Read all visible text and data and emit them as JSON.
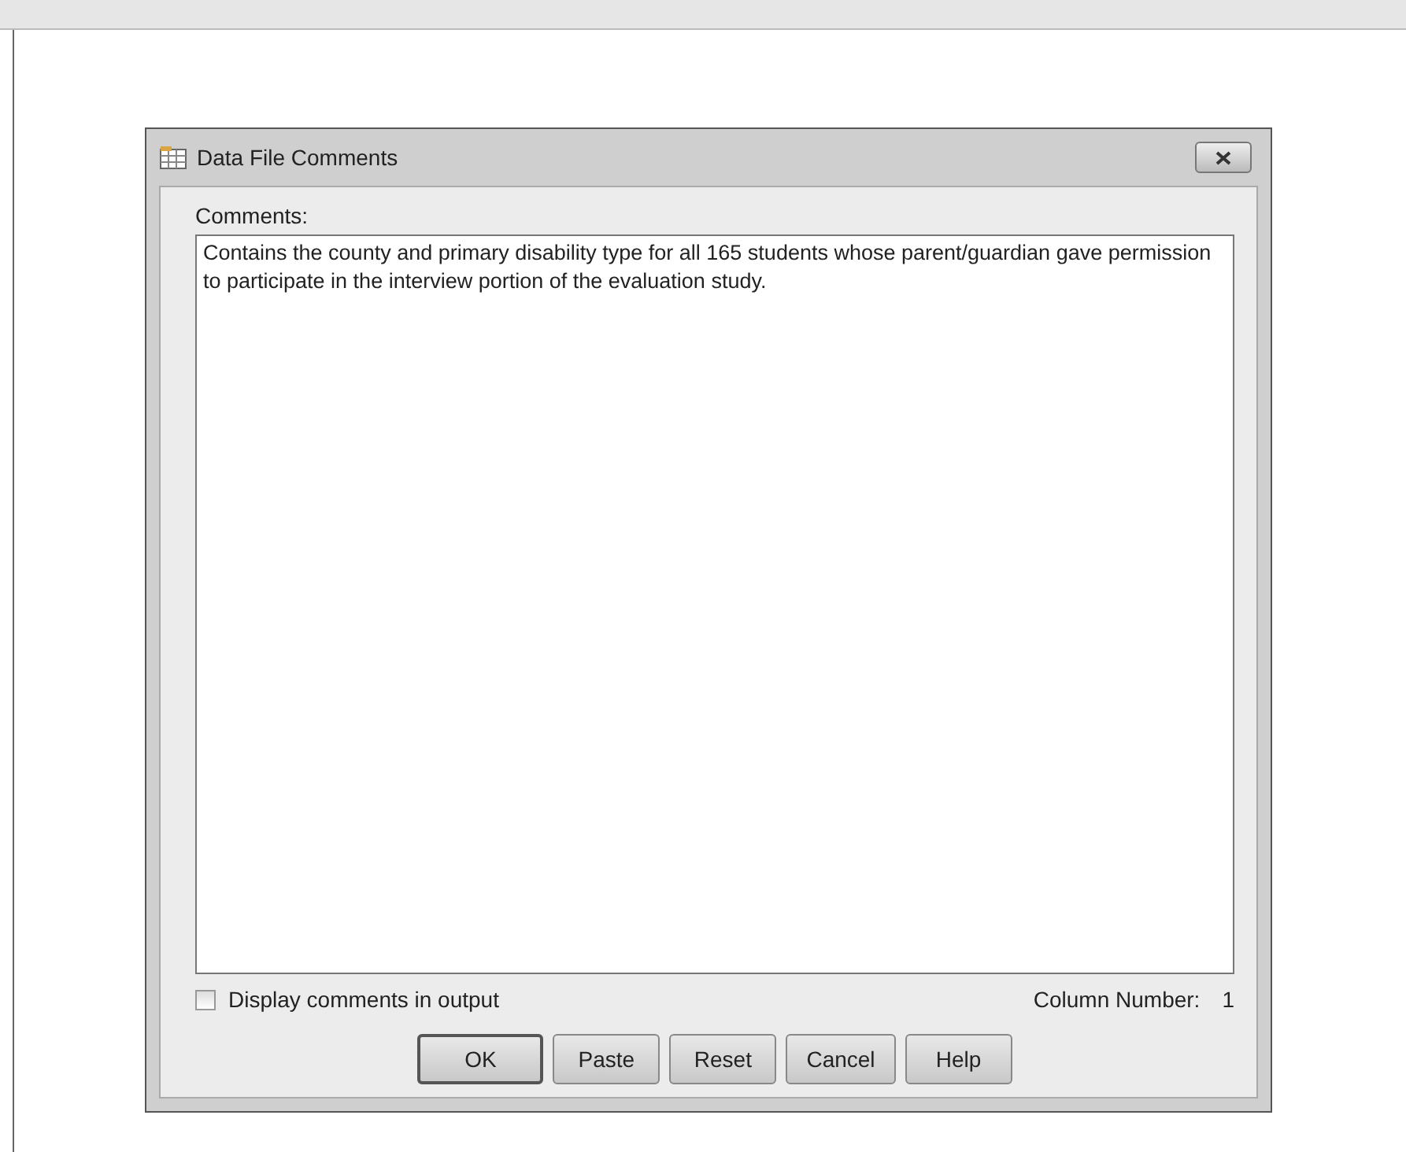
{
  "window": {
    "title": "Data File Comments"
  },
  "comments": {
    "label": "Comments:",
    "value": "Contains the county and primary disability type for all 165 students whose parent/guardian gave permission to participate in the interview portion of the evaluation study.\n\n"
  },
  "display_in_output": {
    "label": "Display comments in output",
    "checked": false
  },
  "column_number": {
    "label": "Column Number:",
    "value": "1"
  },
  "buttons": [
    {
      "label": "OK",
      "default": true
    },
    {
      "label": "Paste",
      "default": false
    },
    {
      "label": "Reset",
      "default": false
    },
    {
      "label": "Cancel",
      "default": false
    },
    {
      "label": "Help",
      "default": false
    }
  ]
}
